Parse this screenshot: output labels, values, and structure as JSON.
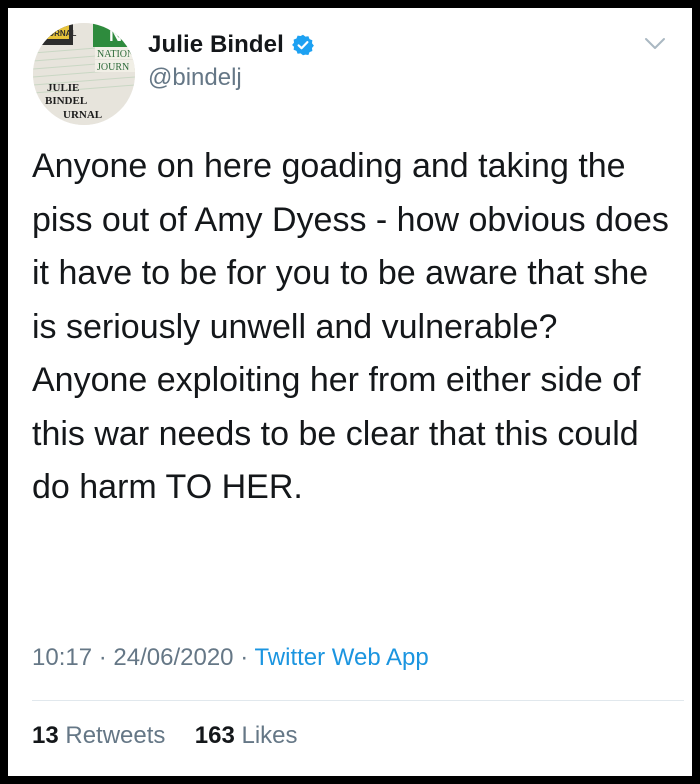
{
  "author": {
    "name": "Julie Bindel",
    "handle": "@bindelj",
    "verified": true,
    "avatar_text": {
      "line1": "JULIE",
      "line2": "BINDEL",
      "line3": "URNAL",
      "badge1": "NATION",
      "badge2": "JOURN",
      "corner": "JOURNAL"
    }
  },
  "tweet": {
    "text": "Anyone on here goading and taking the piss out of Amy Dyess - how obvious does it have to be for you to be aware that she is seriously unwell and vulnerable? Anyone exploiting her from either side of this war needs to be clear that this could do harm TO HER."
  },
  "meta": {
    "time": "10:17",
    "sep1": "·",
    "date": "24/06/2020",
    "sep2": "·",
    "source": "Twitter Web App"
  },
  "stats": {
    "retweets_count": "13",
    "retweets_label": "Retweets",
    "likes_count": "163",
    "likes_label": "Likes"
  },
  "icons": {
    "verified": "verified-badge-icon",
    "menu": "chevron-down-icon"
  },
  "colors": {
    "text": "#14171a",
    "secondary": "#657786",
    "link": "#1b95e0",
    "verified": "#1da1f2",
    "frame": "#000000"
  }
}
